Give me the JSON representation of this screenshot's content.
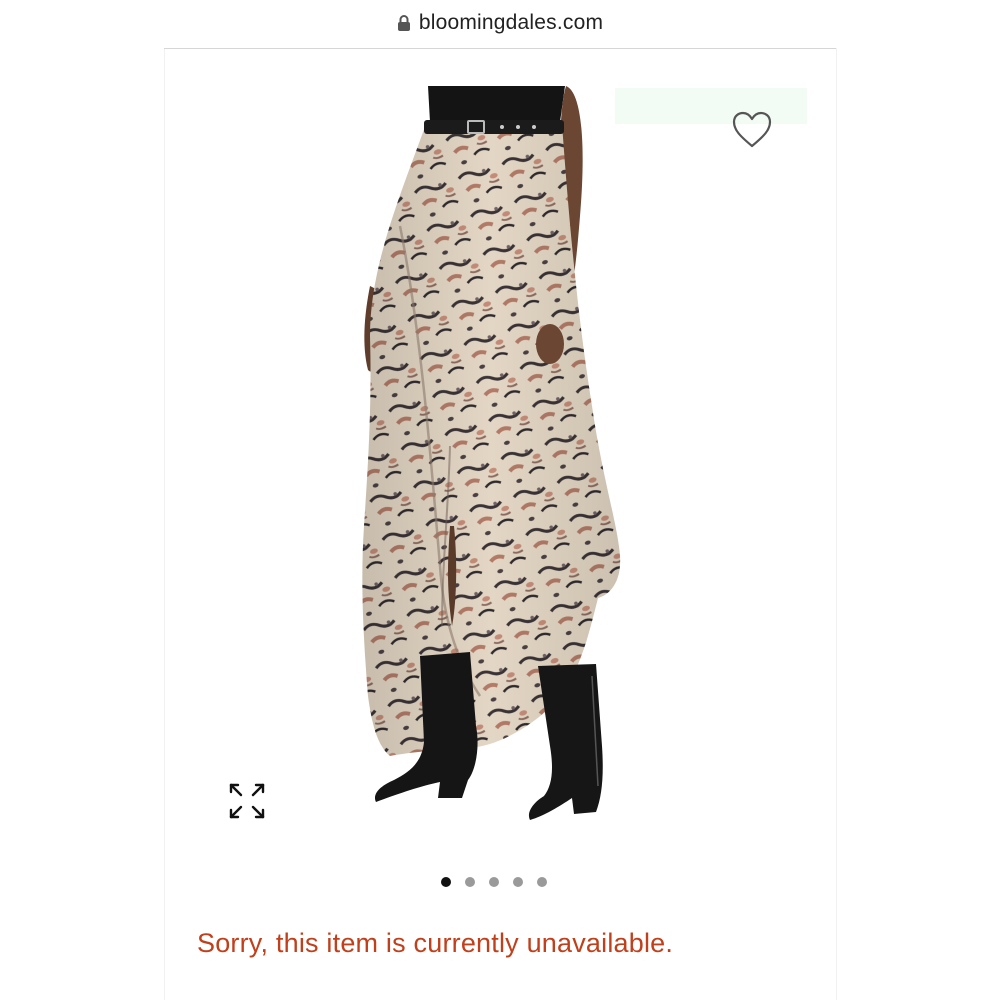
{
  "browser": {
    "url": "bloomingdales.com",
    "lock_icon": "lock-icon"
  },
  "product": {
    "image_alt": "Printed asymmetric ruffle maxi skirt",
    "favorite_icon": "heart-outline-icon",
    "expand_icon": "expand-arrows-icon"
  },
  "carousel": {
    "dots": [
      {
        "active": true
      },
      {
        "active": false
      },
      {
        "active": false
      },
      {
        "active": false
      },
      {
        "active": false
      }
    ]
  },
  "availability": {
    "message": "Sorry, this item is currently unavailable.",
    "color": "#c0401c"
  }
}
